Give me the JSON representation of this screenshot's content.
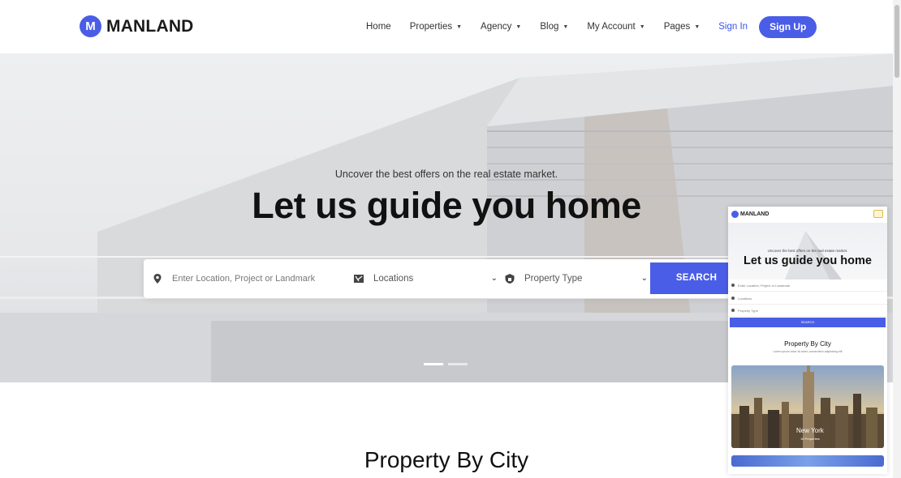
{
  "brand": {
    "name": "MANLAND",
    "color": "#4a5de6"
  },
  "nav": {
    "items": [
      {
        "label": "Home",
        "dropdown": false
      },
      {
        "label": "Properties",
        "dropdown": true
      },
      {
        "label": "Agency",
        "dropdown": true
      },
      {
        "label": "Blog",
        "dropdown": true
      },
      {
        "label": "My Account",
        "dropdown": true
      },
      {
        "label": "Pages",
        "dropdown": true
      }
    ],
    "signin": "Sign In",
    "signup": "Sign Up"
  },
  "hero": {
    "subtitle": "Uncover the best offers on the real estate market.",
    "title": "Let us guide you home",
    "slides": 2,
    "active_slide": 1
  },
  "search": {
    "location_placeholder": "Enter Location, Project or Landmark",
    "locations_value": "Locations",
    "property_type_value": "Property Type",
    "button": "SEARCH"
  },
  "section": {
    "title": "Property By City"
  },
  "preview": {
    "brand": "MANLAND",
    "subtitle": "Uncover the best offers on the real estate market.",
    "title": "Let us guide you home",
    "field_location": "Enter Location, Project or Landmark",
    "field_locations": "Locations",
    "field_type": "Property Type",
    "button": "SEARCH",
    "section_title": "Property By City",
    "section_subtitle": "Lorem ipsum dolor sit amet, consectetur adipisicing elit",
    "card_title": "New York",
    "card_sub": "16 Properties"
  }
}
